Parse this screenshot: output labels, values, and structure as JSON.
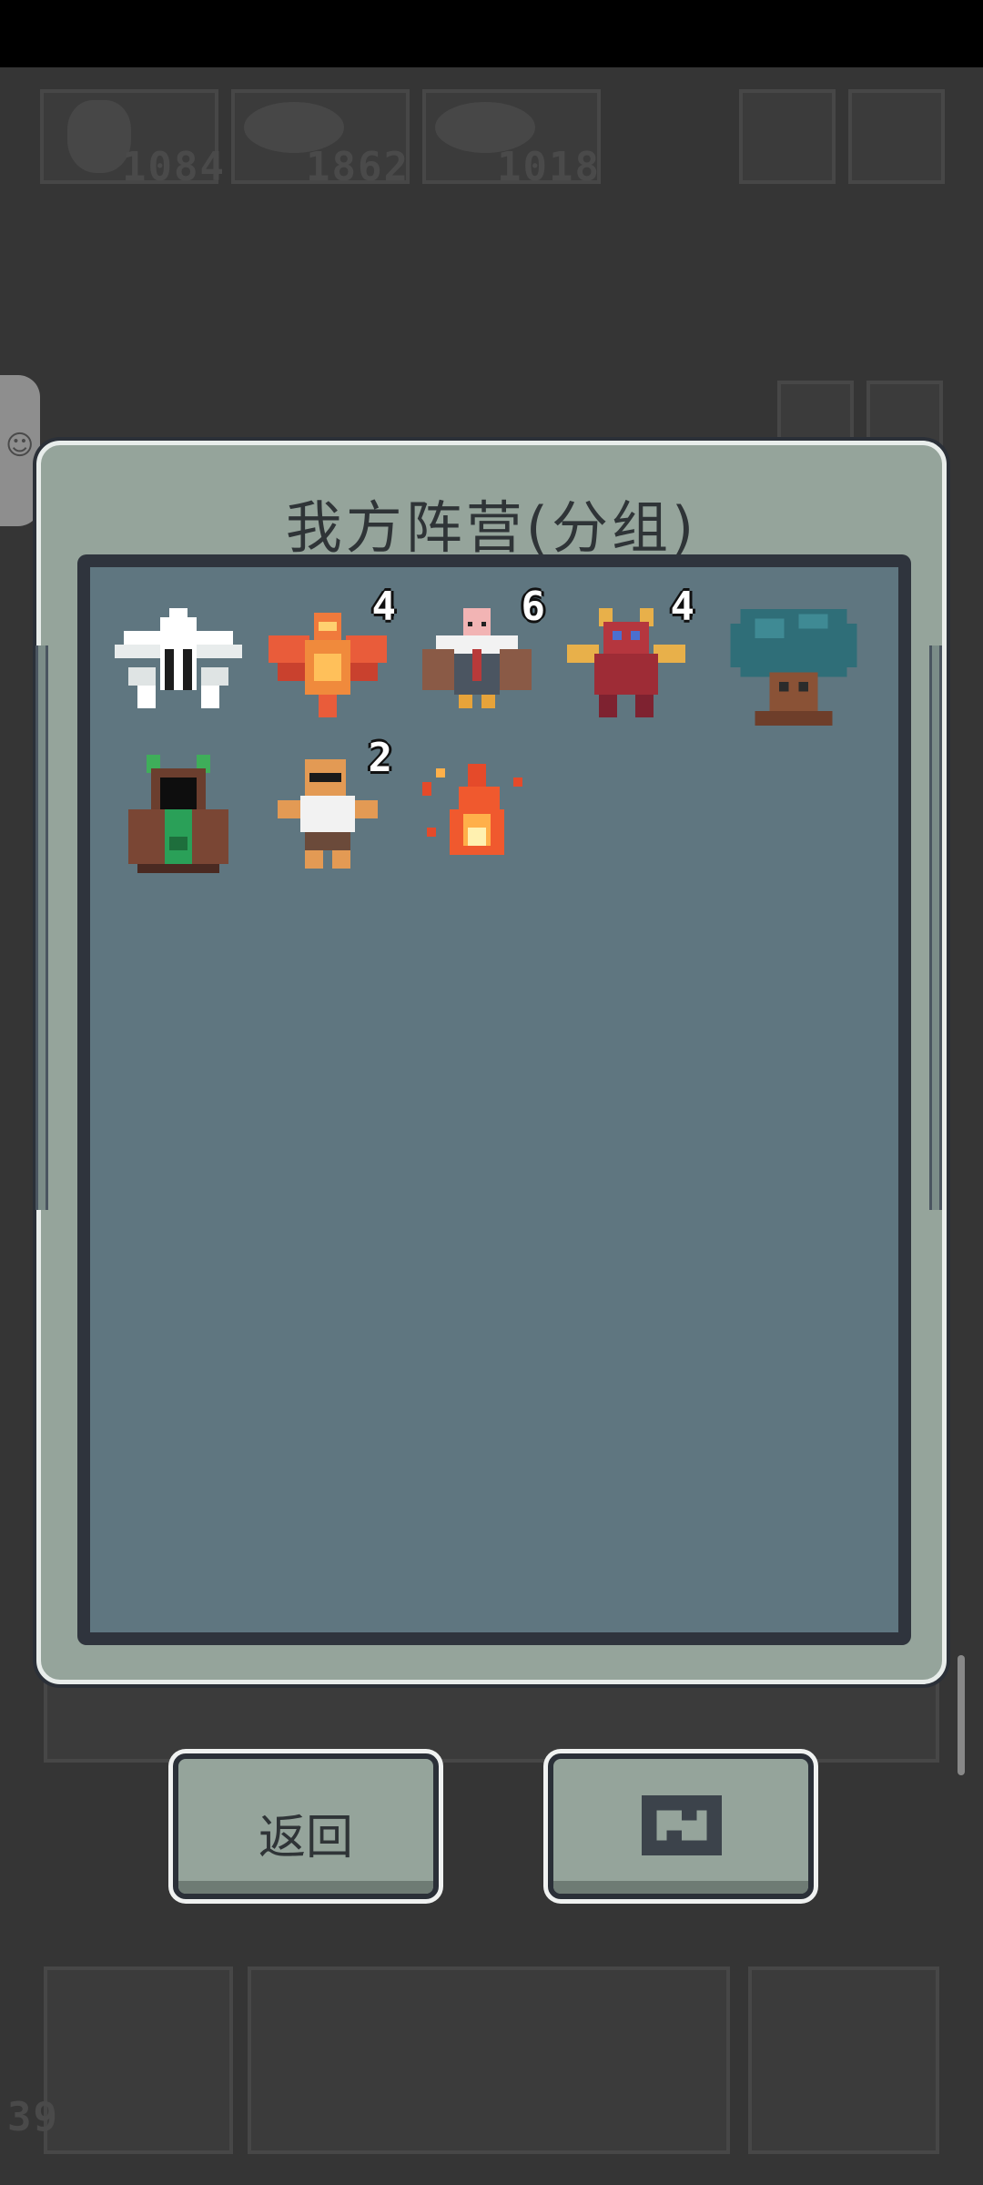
{
  "hud": {
    "resources": [
      {
        "icon": "fire-icon",
        "value": "1084"
      },
      {
        "icon": "meat-icon",
        "value": "1862"
      },
      {
        "icon": "meat-icon",
        "value": "1018"
      }
    ],
    "bottom_counter": "39"
  },
  "dialog": {
    "title": "我方阵营(分组)",
    "units": [
      {
        "name": "white-spirit-unit",
        "count": ""
      },
      {
        "name": "phoenix-unit",
        "count": "4"
      },
      {
        "name": "vulture-unit",
        "count": "6"
      },
      {
        "name": "red-demon-unit",
        "count": "4"
      },
      {
        "name": "tree-ent-unit",
        "count": ""
      },
      {
        "name": "forest-druid-unit",
        "count": ""
      },
      {
        "name": "bald-brawler-unit",
        "count": "2"
      },
      {
        "name": "fire-spirit-unit",
        "count": ""
      }
    ]
  },
  "buttons": {
    "back_label": "返回",
    "swap_icon": "swap-arrows-icon"
  },
  "colors": {
    "panel": "#95a49b",
    "inner": "#5f7680",
    "border": "#2f343d",
    "backdrop": "#353535"
  }
}
